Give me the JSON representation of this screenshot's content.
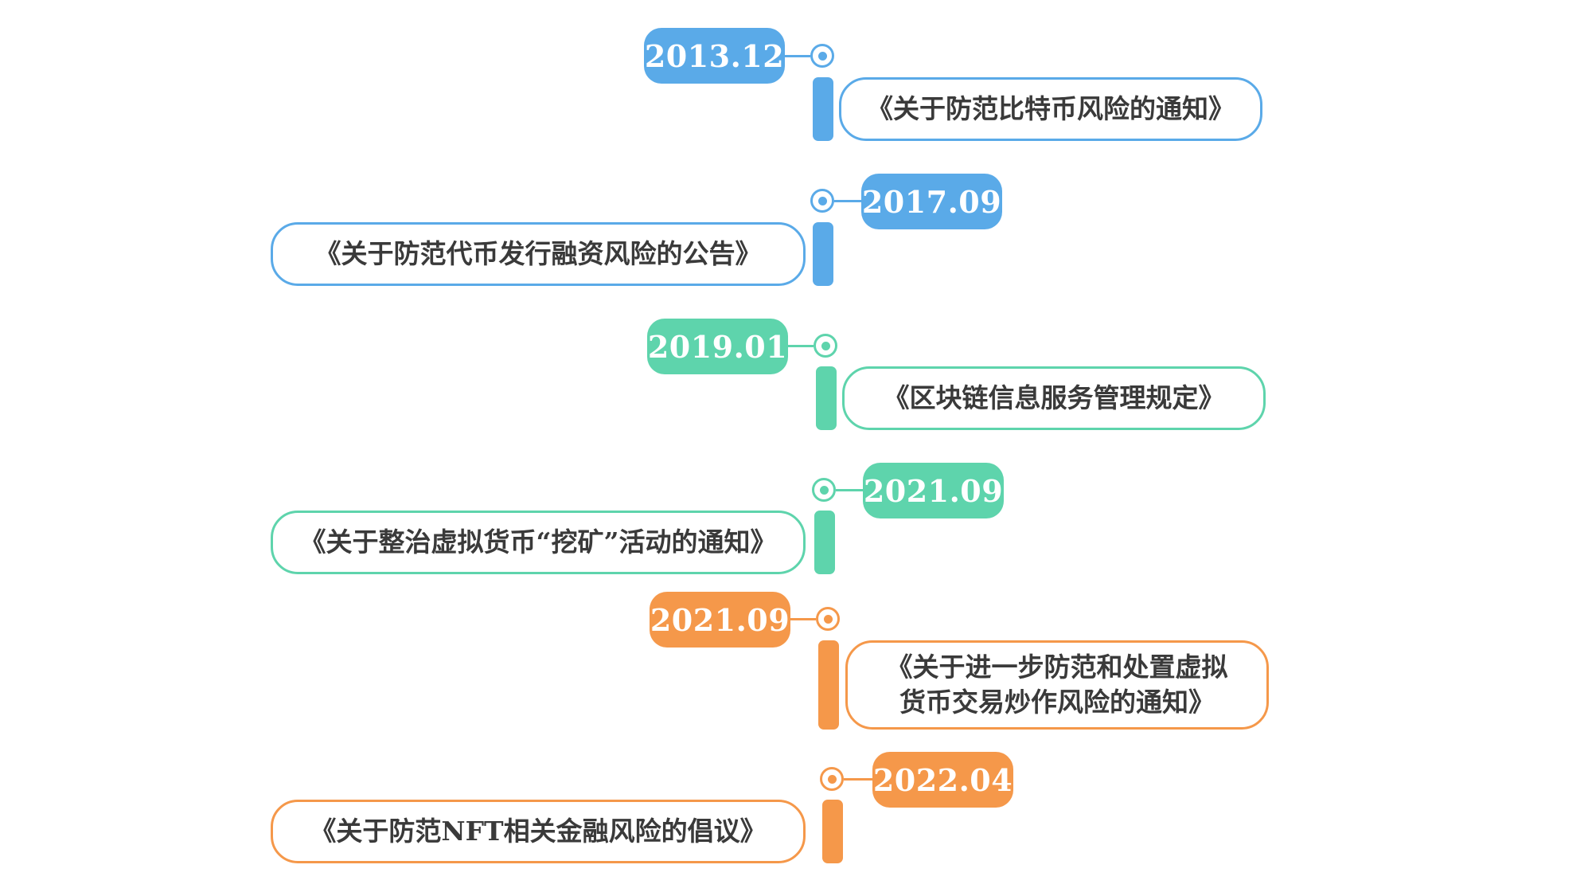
{
  "timeline": {
    "colors": {
      "blue": "#5aaae8",
      "green": "#5ed4ac",
      "orange": "#f5984a"
    },
    "events": [
      {
        "date": "2013.12",
        "document": "《关于防范比特币风险的通知》",
        "color": "blue",
        "box_side": "right"
      },
      {
        "date": "2017.09",
        "document": "《关于防范代币发行融资风险的公告》",
        "color": "blue",
        "box_side": "left"
      },
      {
        "date": "2019.01",
        "document": "《区块链信息服务管理规定》",
        "color": "green",
        "box_side": "right"
      },
      {
        "date": "2021.09",
        "document": "《关于整治虚拟货币“挖矿”活动的通知》",
        "color": "green",
        "box_side": "left"
      },
      {
        "date": "2021.09",
        "document": "《关于进一步防范和处置虚拟\n货币交易炒作风险的通知》",
        "color": "orange",
        "box_side": "right"
      },
      {
        "date": "2022.04",
        "document": "《关于防范NFT相关金融风险的倡议》",
        "color": "orange",
        "box_side": "left"
      }
    ]
  }
}
